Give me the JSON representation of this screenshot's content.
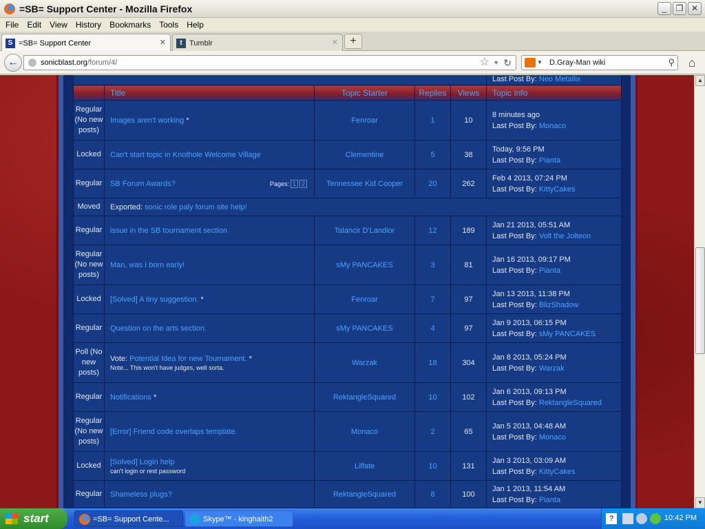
{
  "window": {
    "title": "=SB= Support Center - Mozilla Firefox"
  },
  "menu": [
    "File",
    "Edit",
    "View",
    "History",
    "Bookmarks",
    "Tools",
    "Help"
  ],
  "tabs": [
    {
      "label": "=SB= Support Center",
      "active": true
    },
    {
      "label": "Tumblr",
      "active": false
    }
  ],
  "nav": {
    "url_host": "sonicblast.org",
    "url_path": "/forum/4/",
    "search_text": "D.Gray-Man wiki"
  },
  "forum": {
    "prev_last_post_label": "Last Post By:",
    "prev_last_post_user": "Neo Metallix",
    "headers": {
      "title": "Title",
      "starter": "Topic Starter",
      "replies": "Replies",
      "views": "Views",
      "info": "Topic Info"
    },
    "last_post_label": "Last Post By:",
    "pages_label": "Pages:",
    "moved": {
      "status": "Moved",
      "prefix": "Exported:",
      "link": "sonic role paly forum site help!"
    },
    "topics": [
      {
        "status": "Regular (No new posts)",
        "prefix": "",
        "title": "Images aren't working",
        "mark": " *",
        "sub": "",
        "pages": [],
        "starter": "Fenroar",
        "replies": "1",
        "views": "10",
        "date": "8 minutes ago",
        "last_user": "Monaco"
      },
      {
        "status": "Locked",
        "prefix": "",
        "title": "Can't start topic in Knothole Welcome Village",
        "mark": "",
        "sub": "",
        "pages": [],
        "starter": "Clementine",
        "replies": "5",
        "views": "38",
        "date": "Today, 9:56 PM",
        "last_user": "Pianta"
      },
      {
        "status": "Regular",
        "prefix": "",
        "title": "SB Forum Awards?",
        "mark": "",
        "sub": "",
        "pages": [
          "1",
          "2"
        ],
        "starter": "Tennessee Kid Cooper",
        "replies": "20",
        "views": "262",
        "date": "Feb 4 2013, 07:24 PM",
        "last_user": "KittyCakes"
      },
      {
        "moved": true
      },
      {
        "status": "Regular",
        "prefix": "",
        "title": "issue in the SB tournament section",
        "mark": "",
        "sub": "",
        "pages": [],
        "starter": "Talancir D'Landior",
        "replies": "12",
        "views": "189",
        "date": "Jan 21 2013, 05:51 AM",
        "last_user": "Volt the Jolteon"
      },
      {
        "status": "Regular (No new posts)",
        "prefix": "",
        "title": "Man, was I born early!",
        "mark": "",
        "sub": "",
        "pages": [],
        "starter": "sMy PANCAKES",
        "replies": "3",
        "views": "81",
        "date": "Jan 16 2013, 09:17 PM",
        "last_user": "Pianta"
      },
      {
        "status": "Locked",
        "prefix": "",
        "title": "[Solved] A tiny suggestion.",
        "mark": " *",
        "sub": "",
        "pages": [],
        "starter": "Fenroar",
        "replies": "7",
        "views": "97",
        "date": "Jan 13 2013, 11:38 PM",
        "last_user": "BlizShadow"
      },
      {
        "status": "Regular",
        "prefix": "",
        "title": "Question on the arts section.",
        "mark": "",
        "sub": "",
        "pages": [],
        "starter": "sMy PANCAKES",
        "replies": "4",
        "views": "97",
        "date": "Jan 9 2013, 06:15 PM",
        "last_user": "sMy PANCAKES"
      },
      {
        "status": "Poll (No new posts)",
        "prefix": "Vote: ",
        "title": "Potential Idea for new Tournament.",
        "mark": " *",
        "sub": "Note... This won't have judges, well sorta.",
        "pages": [],
        "starter": "Warzak",
        "replies": "18",
        "views": "304",
        "date": "Jan 8 2013, 05:24 PM",
        "last_user": "Warzak"
      },
      {
        "status": "Regular",
        "prefix": "",
        "title": "Notifications",
        "mark": " *",
        "sub": "",
        "pages": [],
        "starter": "RektangleSquared",
        "replies": "10",
        "views": "102",
        "date": "Jan 6 2013, 09:13 PM",
        "last_user": "RektangleSquared"
      },
      {
        "status": "Regular (No new posts)",
        "prefix": "",
        "title": "[Error] Friend code overlaps template.",
        "mark": "",
        "sub": "",
        "pages": [],
        "starter": "Monaco",
        "replies": "2",
        "views": "65",
        "date": "Jan 5 2013, 04:48 AM",
        "last_user": "Monaco"
      },
      {
        "status": "Locked",
        "prefix": "",
        "title": "[Solved] Login help",
        "mark": "",
        "sub": "can't login or rest password",
        "pages": [],
        "starter": "Lilfate",
        "replies": "10",
        "views": "131",
        "date": "Jan 3 2013, 03:09 AM",
        "last_user": "KittyCakes"
      },
      {
        "status": "Regular",
        "prefix": "",
        "title": "Shameless plugs?",
        "mark": "",
        "sub": "",
        "pages": [],
        "starter": "RektangleSquared",
        "replies": "8",
        "views": "100",
        "date": "Jan 1 2013, 11:54 AM",
        "last_user": "Pianta"
      }
    ]
  },
  "taskbar": {
    "start_label": "start",
    "items": [
      "=SB= Support Cente...",
      "Skype™ - kinghaith2"
    ],
    "clock": "10:42 PM"
  },
  "colors": {
    "link": "#49a3ff",
    "row_bg": "#173a85",
    "page_bg": "#8d1818"
  }
}
